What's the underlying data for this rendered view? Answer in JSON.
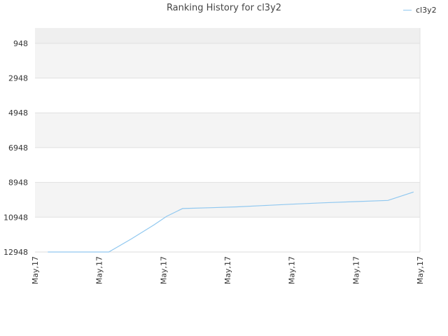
{
  "chart_data": {
    "type": "line",
    "title": "Ranking History for cl3y2",
    "xlabel": "",
    "ylabel": "",
    "y_inverted": true,
    "ylim": [
      12948,
      948
    ],
    "yticks": [
      948,
      2948,
      4948,
      6948,
      8948,
      10948,
      12948
    ],
    "ytick_labels": [
      "948",
      "2948",
      "4948",
      "6948",
      "8948",
      "10948",
      "12948"
    ],
    "xtick_labels": [
      "May,17",
      "May,17",
      "May,17",
      "May,17",
      "May,17",
      "May,17",
      "May,17",
      "May,17",
      "May,17",
      "May,17",
      "May,17",
      "May,17",
      "May,17"
    ],
    "grid": true,
    "legend": "top-right",
    "series": [
      {
        "name": "cl3y2",
        "color": "#90c8f0",
        "x": [
          0.4,
          1.0,
          1.6,
          2.3,
          3.0,
          3.7,
          4.1,
          4.6,
          5.5,
          6.3,
          7.1,
          8.0,
          9.0,
          10.0,
          11.0,
          11.8
        ],
        "values": [
          12948,
          12948,
          12948,
          12948,
          12200,
          11400,
          10900,
          10450,
          10400,
          10350,
          10280,
          10200,
          10120,
          10050,
          9980,
          9500
        ]
      }
    ],
    "accent_color": "#90c8f0"
  }
}
